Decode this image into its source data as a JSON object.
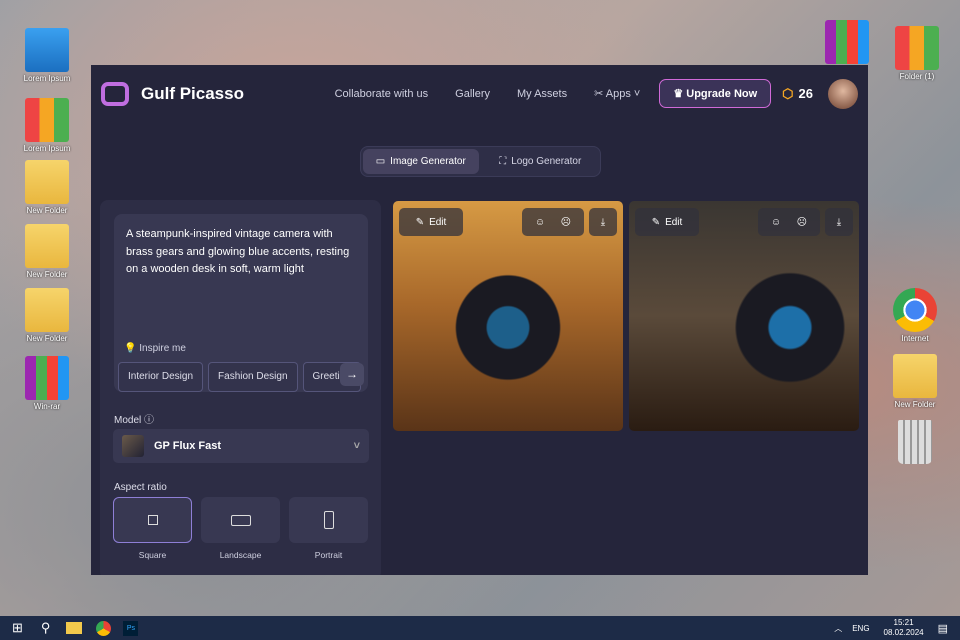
{
  "desktop": {
    "left": [
      "Lorem Ipsum",
      "Lorem Ipsum",
      "New Folder",
      "New Folder",
      "New Folder",
      "Win-rar"
    ],
    "right": [
      "Folder (1)",
      "Internet",
      "New Folder"
    ]
  },
  "app": {
    "brand": "Gulf Picasso",
    "nav": [
      "Collaborate with us",
      "Gallery",
      "My Assets",
      "Apps"
    ],
    "upgrade": "Upgrade Now",
    "credits": "26",
    "tabs": [
      "Image Generator",
      "Logo Generator"
    ],
    "prompt": "A steampunk-inspired vintage camera with brass gears and glowing blue accents, resting on a wooden desk in soft, warm light",
    "inspire": "Inspire me",
    "chips": [
      "Interior Design",
      "Fashion Design",
      "Greeting"
    ],
    "model_label": "Model",
    "model": "GP Flux Fast",
    "aspect_label": "Aspect ratio",
    "aspects": [
      "Square",
      "Landscape",
      "Portrait"
    ],
    "edit": "Edit"
  },
  "taskbar": {
    "lang": "ENG",
    "time": "15:21",
    "date": "08.02.2024"
  }
}
